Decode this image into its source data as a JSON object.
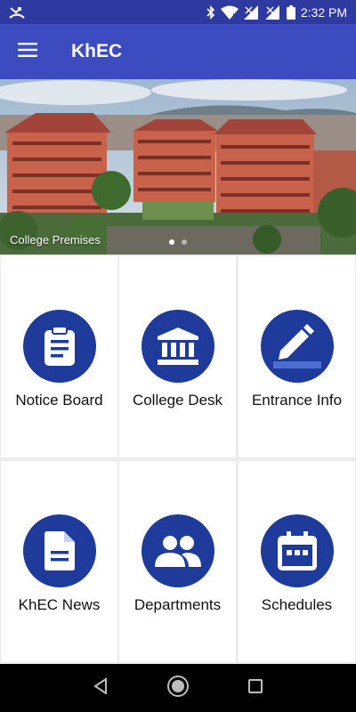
{
  "status_bar": {
    "time": "2:32 PM"
  },
  "app_bar": {
    "title": "KhEC"
  },
  "banner": {
    "caption": "College Premises",
    "slide_count": 2,
    "active_slide": 1
  },
  "tiles": [
    {
      "label": "Notice Board",
      "icon": "clipboard-icon"
    },
    {
      "label": "College Desk",
      "icon": "institution-icon"
    },
    {
      "label": "Entrance Info",
      "icon": "pencil-icon"
    },
    {
      "label": "KhEC News",
      "icon": "document-icon"
    },
    {
      "label": "Departments",
      "icon": "people-icon"
    },
    {
      "label": "Schedules",
      "icon": "calendar-icon"
    }
  ],
  "colors": {
    "status_bar": "#2f3aa0",
    "app_bar": "#3c4bbf",
    "icon_circle": "#1e3a9a",
    "background": "#ececec"
  }
}
